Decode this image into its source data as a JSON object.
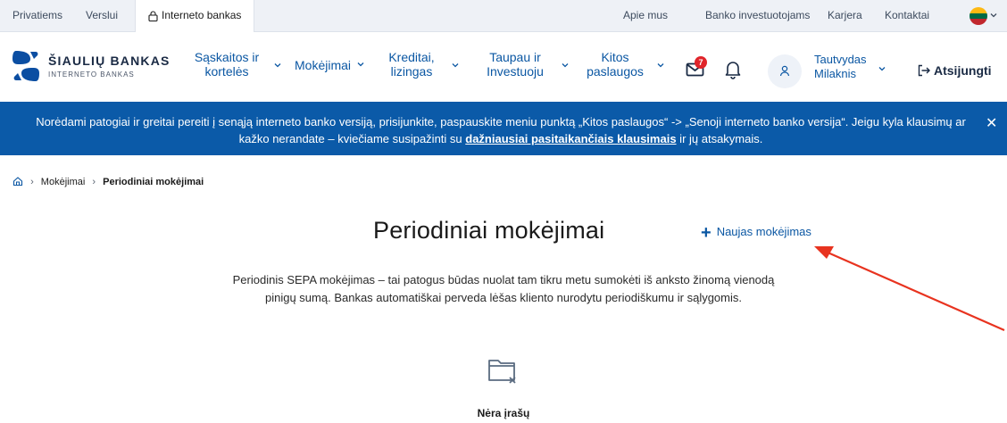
{
  "topbar": {
    "tabs": [
      {
        "label": "Privatiems"
      },
      {
        "label": "Verslui"
      },
      {
        "label": "Interneto bankas"
      }
    ],
    "links": [
      {
        "label": "Apie mus"
      },
      {
        "label": "Banko investuotojams"
      },
      {
        "label": "Karjera"
      },
      {
        "label": "Kontaktai"
      }
    ],
    "language_flag": "lithuania-flag-icon"
  },
  "brand": {
    "name": "ŠIAULIŲ BANKAS",
    "sub": "INTERNETO BANKAS"
  },
  "nav": {
    "items": [
      {
        "label_line1": "Sąskaitos ir",
        "label_line2": "kortelės"
      },
      {
        "label_line1": "Mokėjimai",
        "label_line2": ""
      },
      {
        "label_line1": "Kreditai,",
        "label_line2": "lizingas"
      },
      {
        "label_line1": "Taupau ir",
        "label_line2": "Investuoju"
      },
      {
        "label_line1": "Kitos",
        "label_line2": "paslaugos"
      }
    ],
    "messages_badge": "7",
    "user_first": "Tautvydas",
    "user_last": "Milaknis",
    "logout_label": "Atsijungti"
  },
  "banner": {
    "text_part1": "Norėdami patogiai ir greitai pereiti į senąją interneto banko versiją, prisijunkite, paspauskite meniu punktą „Kitos paslaugos“ -> „Senoji interneto banko versija“. Jeigu kyla klausimų ar kažko nerandate – kviečiame susipažinti su ",
    "link": "dažniausiai pasitaikančiais klausimais",
    "text_part2": " ir jų atsakymais."
  },
  "breadcrumb": {
    "items": [
      "Mokėjimai",
      "Periodiniai mokėjimai"
    ]
  },
  "main": {
    "title": "Periodiniai mokėjimai",
    "new_payment_label": "Naujas mokėjimas",
    "description_line1": "Periodinis SEPA mokėjimas – tai patogus būdas nuolat tam tikru metu sumokėti iš anksto žinomą vienodą",
    "description_line2": "pinigų sumą. Bankas automatiškai perveda lėšas kliento nurodytu periodiškumu ir sąlygomis.",
    "empty_text": "Nėra įrašų"
  },
  "colors": {
    "primary_blue": "#0b57a3",
    "banner_blue": "#0b5aa8",
    "badge_red": "#e0242a",
    "annotation_red": "#e8331f"
  }
}
